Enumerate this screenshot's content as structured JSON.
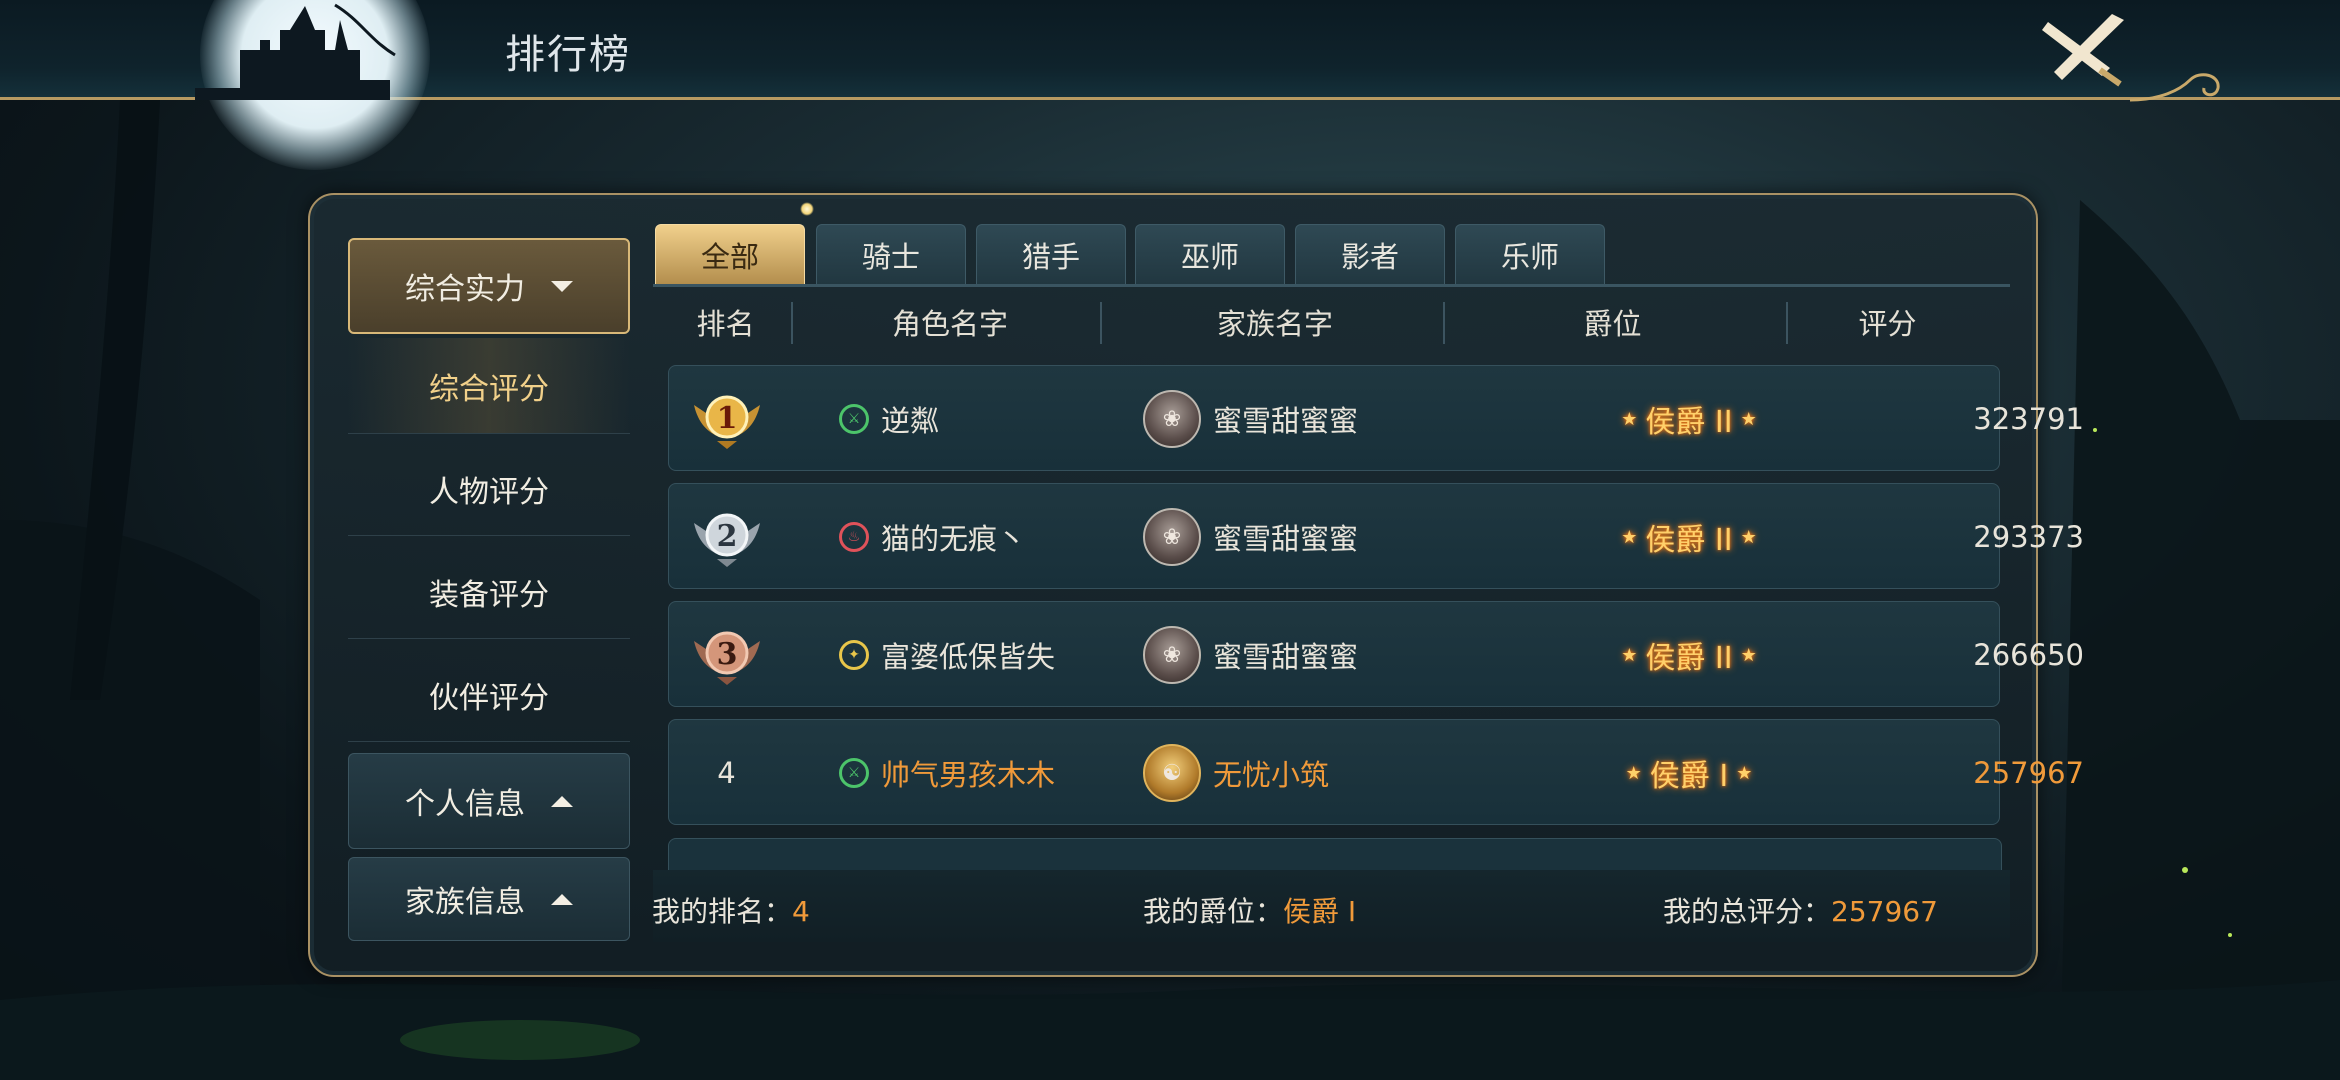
{
  "page_title": "排行榜",
  "sidebar": {
    "categories": [
      {
        "label": "综合实力",
        "expanded": true
      },
      {
        "label": "个人信息",
        "expanded": false
      },
      {
        "label": "家族信息",
        "expanded": false
      }
    ],
    "sub_items": [
      "综合评分",
      "人物评分",
      "装备评分",
      "伙伴评分"
    ],
    "selected_sub": "综合评分"
  },
  "tabs": [
    "全部",
    "骑士",
    "猎手",
    "巫师",
    "影者",
    "乐师"
  ],
  "selected_tab": "全部",
  "columns": [
    "排名",
    "角色名字",
    "家族名字",
    "爵位",
    "评分"
  ],
  "rows": [
    {
      "rank": "1",
      "name": "逆粼",
      "class_icon": "knight-class-icon",
      "family": "蜜雪甜蜜蜜",
      "title": "侯爵 II",
      "score": "323791",
      "highlight": false
    },
    {
      "rank": "2",
      "name": "猫的无痕丶",
      "class_icon": "fire-class-icon",
      "family": "蜜雪甜蜜蜜",
      "title": "侯爵 II",
      "score": "293373",
      "highlight": false
    },
    {
      "rank": "3",
      "name": "富婆低保皆失",
      "class_icon": "hunter-class-icon",
      "family": "蜜雪甜蜜蜜",
      "title": "侯爵 II",
      "score": "266650",
      "highlight": false
    },
    {
      "rank": "4",
      "name": "帅气男孩木木",
      "class_icon": "knight-class-icon",
      "family": "无忧小筑",
      "title": "侯爵 I",
      "score": "257967",
      "highlight": true
    }
  ],
  "footer": {
    "my_rank_label": "我的排名：",
    "my_rank": "4",
    "my_title_label": "我的爵位：",
    "my_title": "侯爵 I",
    "my_score_label": "我的总评分：",
    "my_score": "257967"
  },
  "colors": {
    "accent_gold": "#d8b878",
    "highlight_orange": "#f09a3a",
    "title_glow": "#ffd06a"
  }
}
